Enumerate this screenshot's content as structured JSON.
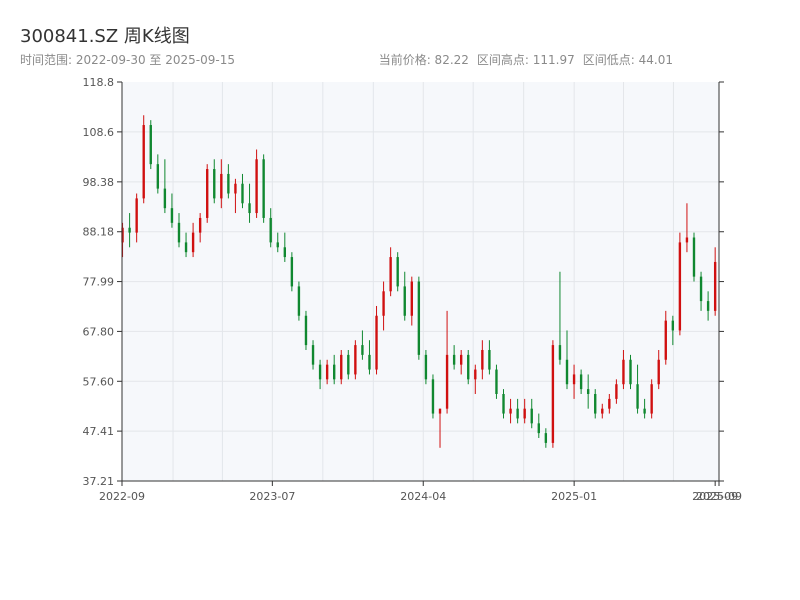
{
  "header": {
    "title": "300841.SZ 周K线图",
    "range_label": "时间范围: 2022-09-30 至 2025-09-15",
    "current_price": "当前价格: 82.22",
    "range_high": "区间高点: 111.97",
    "range_low": "区间低点: 44.01"
  },
  "colors": {
    "up": "#d01010",
    "down": "#108830",
    "grid": "#e3e6ea",
    "plot_bg": "#f6f8fb",
    "axis": "#333333"
  },
  "chart_data": {
    "type": "candlestick",
    "title": "300841.SZ 周K线图",
    "xlabel": "",
    "ylabel": "",
    "ylim": [
      37.21,
      118.8
    ],
    "xlim": [
      "2022-09-30",
      "2025-09-22"
    ],
    "y_ticks": [
      "37.21",
      "47.41",
      "57.60",
      "67.80",
      "77.99",
      "88.18",
      "98.38",
      "108.6",
      "118.8"
    ],
    "x_ticks": [
      {
        "label": "2022-09",
        "date": "2022-09-30"
      },
      {
        "label": "2023-07",
        "date": "2023-07-01"
      },
      {
        "label": "2024-04",
        "date": "2024-04-01"
      },
      {
        "label": "2025-01",
        "date": "2025-01-01"
      },
      {
        "label": "2025-09",
        "date": "2025-09-15"
      },
      {
        "label": "2025-09",
        "date": "2025-09-22"
      }
    ],
    "grid": true,
    "weekly_ohlc_approx": [
      [
        86,
        90,
        83,
        89
      ],
      [
        89,
        92,
        85,
        88
      ],
      [
        88,
        96,
        86,
        95
      ],
      [
        95,
        112,
        94,
        110
      ],
      [
        110,
        111,
        101,
        102
      ],
      [
        102,
        104,
        96,
        97
      ],
      [
        97,
        103,
        92,
        93
      ],
      [
        93,
        96,
        89,
        90
      ],
      [
        90,
        92,
        85,
        86
      ],
      [
        86,
        88,
        83,
        84
      ],
      [
        84,
        90,
        83,
        88
      ],
      [
        88,
        92,
        86,
        91
      ],
      [
        91,
        102,
        90,
        101
      ],
      [
        101,
        103,
        94,
        95
      ],
      [
        95,
        103,
        93,
        100
      ],
      [
        100,
        102,
        95,
        96
      ],
      [
        96,
        99,
        92,
        98
      ],
      [
        98,
        100,
        93,
        94
      ],
      [
        94,
        98,
        90,
        92
      ],
      [
        92,
        105,
        91,
        103
      ],
      [
        103,
        104,
        90,
        91
      ],
      [
        91,
        93,
        85,
        86
      ],
      [
        86,
        88,
        84,
        85
      ],
      [
        85,
        88,
        82,
        83
      ],
      [
        83,
        84,
        76,
        77
      ],
      [
        77,
        78,
        70,
        71
      ],
      [
        71,
        72,
        64,
        65
      ],
      [
        65,
        66,
        60,
        61
      ],
      [
        61,
        62,
        56,
        58
      ],
      [
        58,
        62,
        57,
        61
      ],
      [
        61,
        63,
        57,
        58
      ],
      [
        58,
        64,
        57,
        63
      ],
      [
        63,
        64,
        58,
        59
      ],
      [
        59,
        66,
        58,
        65
      ],
      [
        65,
        68,
        62,
        63
      ],
      [
        63,
        66,
        59,
        60
      ],
      [
        60,
        73,
        59,
        71
      ],
      [
        71,
        78,
        68,
        76
      ],
      [
        76,
        85,
        75,
        83
      ],
      [
        83,
        84,
        76,
        77
      ],
      [
        77,
        80,
        70,
        71
      ],
      [
        71,
        79,
        69,
        78
      ],
      [
        78,
        79,
        62,
        63
      ],
      [
        63,
        64,
        57,
        58
      ],
      [
        58,
        59,
        50,
        51
      ],
      [
        51,
        52,
        44,
        52
      ],
      [
        52,
        72,
        51,
        63
      ],
      [
        63,
        65,
        60,
        61
      ],
      [
        61,
        64,
        59,
        63
      ],
      [
        63,
        64,
        57,
        58
      ],
      [
        58,
        61,
        55,
        60
      ],
      [
        60,
        66,
        58,
        64
      ],
      [
        64,
        66,
        59,
        60
      ],
      [
        60,
        61,
        54,
        55
      ],
      [
        55,
        56,
        50,
        51
      ],
      [
        51,
        54,
        49,
        52
      ],
      [
        52,
        54,
        49,
        50
      ],
      [
        50,
        54,
        49,
        52
      ],
      [
        52,
        54,
        48,
        49
      ],
      [
        49,
        51,
        46,
        47
      ],
      [
        47,
        48,
        44,
        45
      ],
      [
        45,
        66,
        44,
        65
      ],
      [
        65,
        80,
        61,
        62
      ],
      [
        62,
        68,
        56,
        57
      ],
      [
        57,
        61,
        54,
        59
      ],
      [
        59,
        60,
        55,
        56
      ],
      [
        56,
        59,
        52,
        55
      ],
      [
        55,
        56,
        50,
        51
      ],
      [
        51,
        53,
        50,
        52
      ],
      [
        52,
        55,
        51,
        54
      ],
      [
        54,
        58,
        53,
        57
      ],
      [
        57,
        64,
        56,
        62
      ],
      [
        62,
        63,
        56,
        57
      ],
      [
        57,
        61,
        51,
        52
      ],
      [
        52,
        54,
        50,
        51
      ],
      [
        51,
        58,
        50,
        57
      ],
      [
        57,
        64,
        56,
        62
      ],
      [
        62,
        72,
        61,
        70
      ],
      [
        70,
        71,
        65,
        68
      ],
      [
        68,
        88,
        67,
        86
      ],
      [
        86,
        94,
        84,
        87
      ],
      [
        87,
        88,
        78,
        79
      ],
      [
        79,
        80,
        72,
        74
      ],
      [
        74,
        76,
        70,
        72
      ],
      [
        72,
        85,
        71,
        82
      ]
    ]
  }
}
